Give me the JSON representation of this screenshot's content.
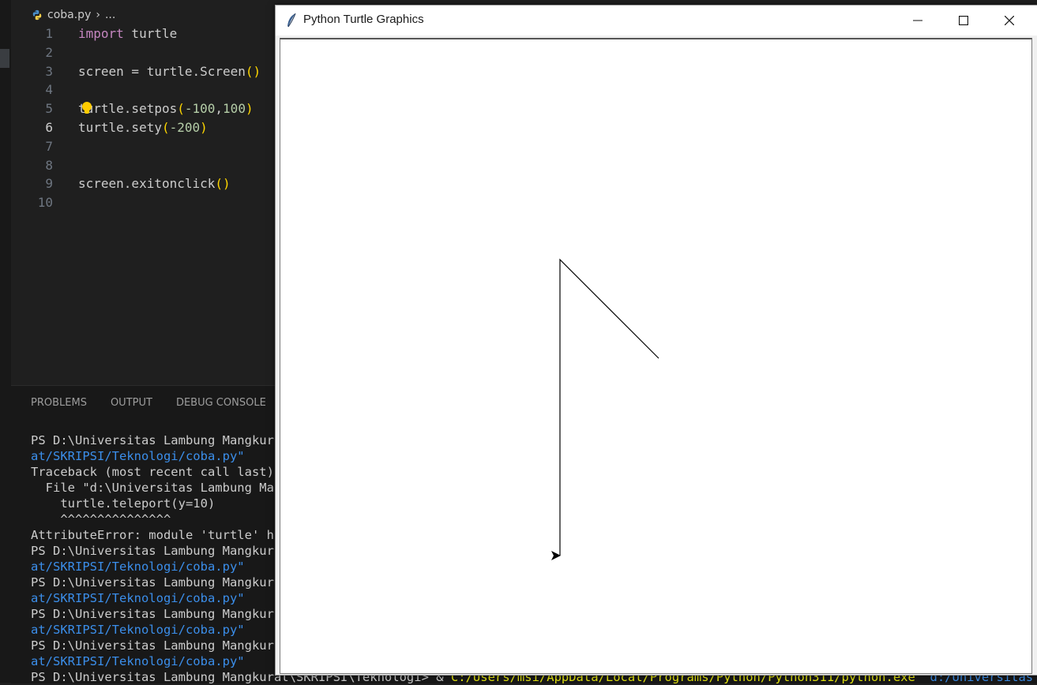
{
  "editor": {
    "breadcrumb": {
      "file": "coba.py",
      "more": "..."
    },
    "lines": [
      {
        "n": "1",
        "parts": [
          {
            "t": "import",
            "c": "kw"
          },
          {
            "t": " turtle",
            "c": ""
          }
        ]
      },
      {
        "n": "2",
        "parts": []
      },
      {
        "n": "3",
        "parts": [
          {
            "t": "screen = turtle.Screen",
            "c": ""
          },
          {
            "t": "()",
            "c": "br"
          }
        ]
      },
      {
        "n": "4",
        "parts": []
      },
      {
        "n": "5",
        "parts": [
          {
            "t": "turtle.setpos",
            "c": ""
          },
          {
            "t": "(",
            "c": "br"
          },
          {
            "t": "-100",
            "c": "num"
          },
          {
            "t": ",",
            "c": ""
          },
          {
            "t": "100",
            "c": "num"
          },
          {
            "t": ")",
            "c": "br"
          }
        ]
      },
      {
        "n": "6",
        "parts": [
          {
            "t": "turtle.sety",
            "c": ""
          },
          {
            "t": "(",
            "c": "br"
          },
          {
            "t": "-200",
            "c": "num"
          },
          {
            "t": ")",
            "c": "br"
          }
        ]
      },
      {
        "n": "7",
        "parts": []
      },
      {
        "n": "8",
        "parts": []
      },
      {
        "n": "9",
        "parts": [
          {
            "t": "screen.exitonclick",
            "c": ""
          },
          {
            "t": "()",
            "c": "br"
          }
        ]
      },
      {
        "n": "10",
        "parts": []
      }
    ]
  },
  "panel": {
    "tabs": [
      "PROBLEMS",
      "OUTPUT",
      "DEBUG CONSOLE"
    ],
    "terminal": [
      [
        {
          "t": "PS D:\\Universitas Lambung Mangkurat",
          "c": ""
        }
      ],
      [
        {
          "t": "at/SKRIPSI/Teknologi/coba.py\"",
          "c": "link"
        }
      ],
      [
        {
          "t": "Traceback (most recent call last):",
          "c": ""
        }
      ],
      [
        {
          "t": "  File \"d:\\Universitas Lambung Mang",
          "c": ""
        }
      ],
      [
        {
          "t": "    turtle.teleport(y=10)",
          "c": ""
        }
      ],
      [
        {
          "t": "    ^^^^^^^^^^^^^^^",
          "c": ""
        }
      ],
      [
        {
          "t": "AttributeError: module 'turtle' has",
          "c": ""
        }
      ],
      [
        {
          "t": "PS D:\\Universitas Lambung Mangkurat",
          "c": ""
        }
      ],
      [
        {
          "t": "at/SKRIPSI/Teknologi/coba.py\"",
          "c": "link"
        }
      ],
      [
        {
          "t": "PS D:\\Universitas Lambung Mangkurat",
          "c": ""
        }
      ],
      [
        {
          "t": "at/SKRIPSI/Teknologi/coba.py\"",
          "c": "link"
        }
      ],
      [
        {
          "t": "PS D:\\Universitas Lambung Mangkurat",
          "c": ""
        }
      ],
      [
        {
          "t": "at/SKRIPSI/Teknologi/coba.py\"",
          "c": "link"
        }
      ],
      [
        {
          "t": "PS D:\\Universitas Lambung Mangkurat",
          "c": ""
        }
      ],
      [
        {
          "t": "at/SKRIPSI/Teknologi/coba.py\"",
          "c": "link"
        }
      ],
      [
        {
          "t": "PS D:\\Universitas Lambung Mangkurat\\SKRIPSI\\Teknologi> & ",
          "c": ""
        },
        {
          "t": "C:/Users/msi/AppData/Local/Programs/Python/Python311/python.exe",
          "c": "yellow"
        },
        {
          "t": "  d:/Universitas Lambu",
          "c": "link"
        }
      ]
    ]
  },
  "turtle_window": {
    "title": "Python Turtle Graphics",
    "buttons": [
      "minimize",
      "maximize",
      "close"
    ]
  },
  "colors": {
    "editor_bg": "#1f1f1f",
    "panel_bg": "#181818",
    "keyword": "#c586c0",
    "number": "#b5cea8",
    "bracket": "#ffd700",
    "link": "#3b8eea"
  }
}
